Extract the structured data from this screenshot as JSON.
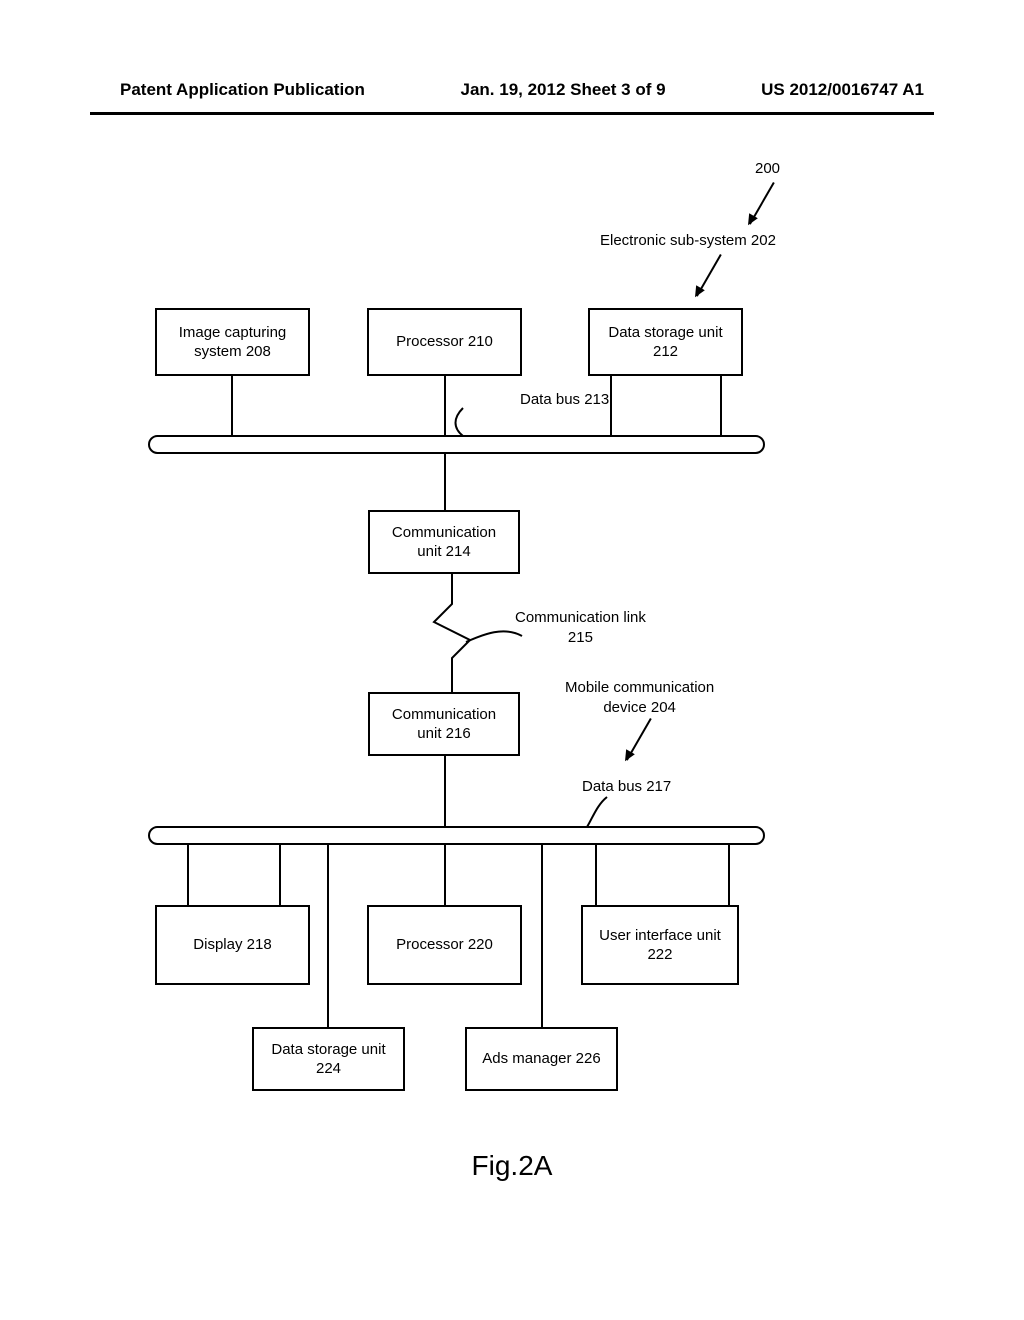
{
  "header": {
    "left": "Patent Application Publication",
    "center": "Jan. 19, 2012  Sheet 3 of 9",
    "right": "US 2012/0016747 A1"
  },
  "diagram": {
    "ref200": "200",
    "subsystem": "Electronic sub-system 202",
    "imageCapture": "Image capturing\nsystem 208",
    "processor1": "Processor 210",
    "dataStorage1": "Data storage unit\n212",
    "dataBus1": "Data bus 213",
    "commUnit1": "Communication\nunit 214",
    "commLink": "Communication link\n215",
    "commUnit2": "Communication\nunit 216",
    "mobileDevice": "Mobile communication\ndevice 204",
    "dataBus2": "Data bus 217",
    "display": "Display 218",
    "processor2": "Processor 220",
    "userInterface": "User interface unit\n222",
    "dataStorage2": "Data storage unit\n224",
    "adsManager": "Ads manager 226"
  },
  "figureLabel": "Fig.2A"
}
